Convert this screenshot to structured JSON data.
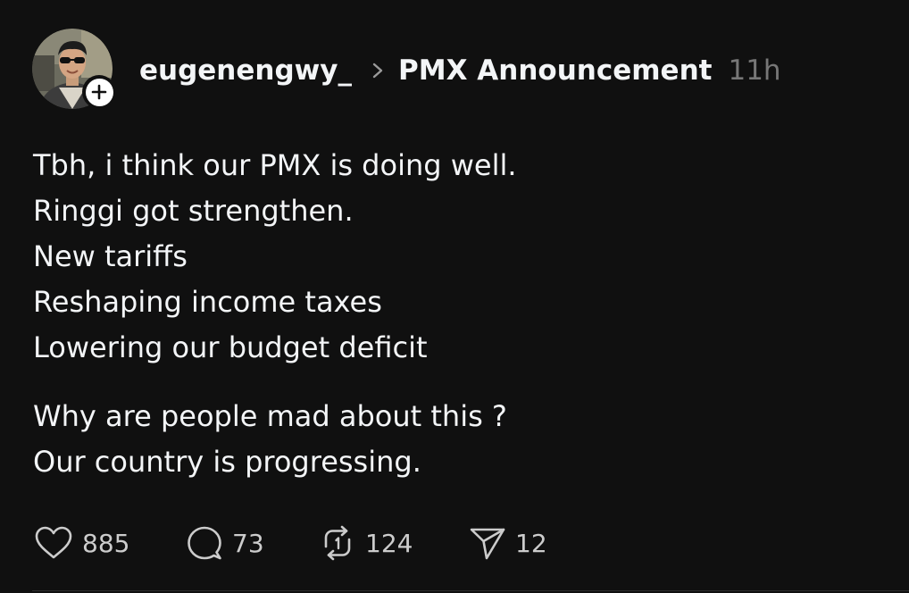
{
  "post": {
    "username": "eugenengwy_",
    "community": "PMX Announcement",
    "time": "11h",
    "lines_group1": [
      "Tbh, i think our PMX is doing well.",
      "Ringgi got strengthen.",
      "New tariffs",
      "Reshaping income taxes",
      "Lowering our budget deficit"
    ],
    "lines_group2": [
      "Why are people mad about this ?",
      "Our country is progressing."
    ]
  },
  "actions": {
    "likes": "885",
    "replies": "73",
    "reposts": "124",
    "shares": "12"
  },
  "icons": {
    "follow": "plus-icon",
    "separator": "chevron-right-icon",
    "like": "heart-icon",
    "reply": "comment-icon",
    "repost": "repost-icon",
    "share": "send-icon"
  },
  "colors": {
    "background": "#101010",
    "text": "#f3f5f7",
    "muted": "#777777",
    "counts": "#cccccc"
  }
}
